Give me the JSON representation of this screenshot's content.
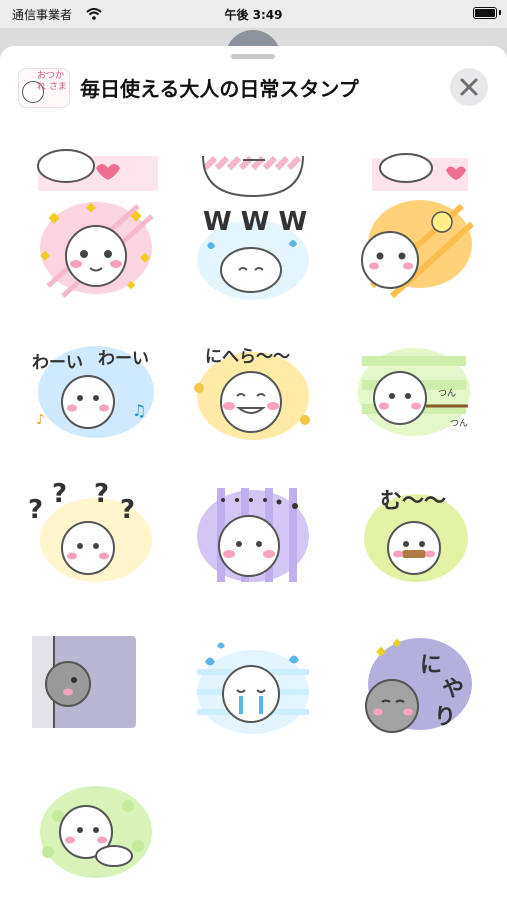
{
  "status_bar": {
    "carrier": "通信事業者",
    "time": "午後 3:49",
    "wifi_icon": "wifi-icon",
    "battery_icon": "battery-icon"
  },
  "sheet": {
    "app_icon_text": "おつかれ さま",
    "title": "毎日使える大人の日常スタンプ",
    "close_icon": "close-icon"
  },
  "stickers": [
    {
      "id": "s01",
      "text": "",
      "bg": "#f9c9d8"
    },
    {
      "id": "s02",
      "text": "",
      "bg": "#f4b6c8"
    },
    {
      "id": "s03",
      "text": "",
      "bg": "#f9c9d8"
    },
    {
      "id": "s04",
      "text": "",
      "bg": "#f8c0d3"
    },
    {
      "id": "s05",
      "text": "www",
      "bg": "#d7efff"
    },
    {
      "id": "s06",
      "text": "",
      "bg": "#ffd27a"
    },
    {
      "id": "s07",
      "text": "わーい わーい",
      "bg": "#bfe5ff"
    },
    {
      "id": "s08",
      "text": "にへら〜〜",
      "bg": "#ffe69a"
    },
    {
      "id": "s09",
      "text": "つん つん",
      "bg": "#cff0a8"
    },
    {
      "id": "s10",
      "text": "?? ??",
      "bg": "#fff1b0"
    },
    {
      "id": "s11",
      "text": ". . . . . .",
      "bg": "#c6b6f0"
    },
    {
      "id": "s12",
      "text": "む〜〜",
      "bg": "#dff2a6"
    },
    {
      "id": "s13",
      "text": "",
      "bg": "#b7b5cc"
    },
    {
      "id": "s14",
      "text": "",
      "bg": "#cdeeff"
    },
    {
      "id": "s15",
      "text": "にやり",
      "bg": "#a9a6d8"
    },
    {
      "id": "s16",
      "text": "",
      "bg": "#cff0a8"
    }
  ]
}
